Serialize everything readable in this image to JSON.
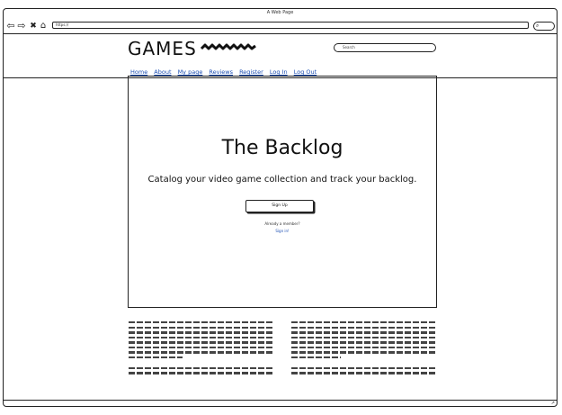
{
  "window": {
    "title": "A Web Page"
  },
  "browser": {
    "url": "https://",
    "back_icon": "arrow-left-icon",
    "forward_icon": "arrow-right-icon",
    "stop_icon": "close-icon",
    "home_icon": "home-icon"
  },
  "site": {
    "brand": "GAMES",
    "search_placeholder": "Search",
    "nav": [
      "Home",
      "About",
      "My page",
      "Reviews",
      "Register",
      "Log In",
      "Log Out"
    ]
  },
  "hero": {
    "title": "The Backlog",
    "tagline": "Catalog your video game collection and track your backlog.",
    "signup_label": "Sign Up",
    "member_text": "Already a member?",
    "signin_label": "Sign in!"
  }
}
